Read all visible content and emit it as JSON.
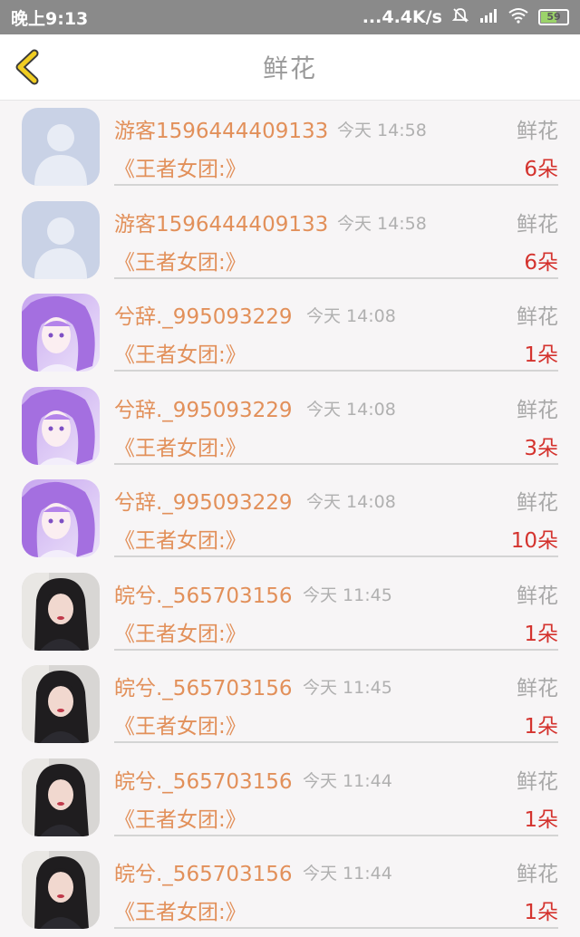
{
  "status_bar": {
    "time": "晚上9:13",
    "network_speed": "...4.4K/s",
    "battery_level": "59"
  },
  "header": {
    "title": "鲜花"
  },
  "colors": {
    "accent": "#e2905a",
    "count_red": "#d4332e",
    "back_yellow": "#e8c21b"
  },
  "records": [
    {
      "name": "游客1596444409133",
      "time": "今天 14:58",
      "gift": "鲜花",
      "group": "《王者女团:》",
      "count": "6朵",
      "avatar": "default-avatar"
    },
    {
      "name": "游客1596444409133",
      "time": "今天 14:58",
      "gift": "鲜花",
      "group": "《王者女团:》",
      "count": "6朵",
      "avatar": "default-avatar"
    },
    {
      "name": "兮辞._995093229",
      "time": "今天 14:08",
      "gift": "鲜花",
      "group": "《王者女团:》",
      "count": "1朵",
      "avatar": "anime-girl-avatar"
    },
    {
      "name": "兮辞._995093229",
      "time": "今天 14:08",
      "gift": "鲜花",
      "group": "《王者女团:》",
      "count": "3朵",
      "avatar": "anime-girl-avatar"
    },
    {
      "name": "兮辞._995093229",
      "time": "今天 14:08",
      "gift": "鲜花",
      "group": "《王者女团:》",
      "count": "10朵",
      "avatar": "anime-girl-avatar"
    },
    {
      "name": "皖兮._565703156",
      "time": "今天 11:45",
      "gift": "鲜花",
      "group": "《王者女团:》",
      "count": "1朵",
      "avatar": "girl-photo-avatar"
    },
    {
      "name": "皖兮._565703156",
      "time": "今天 11:45",
      "gift": "鲜花",
      "group": "《王者女团:》",
      "count": "1朵",
      "avatar": "girl-photo-avatar"
    },
    {
      "name": "皖兮._565703156",
      "time": "今天 11:44",
      "gift": "鲜花",
      "group": "《王者女团:》",
      "count": "1朵",
      "avatar": "girl-photo-avatar"
    },
    {
      "name": "皖兮._565703156",
      "time": "今天 11:44",
      "gift": "鲜花",
      "group": "《王者女团:》",
      "count": "1朵",
      "avatar": "girl-photo-avatar"
    }
  ]
}
